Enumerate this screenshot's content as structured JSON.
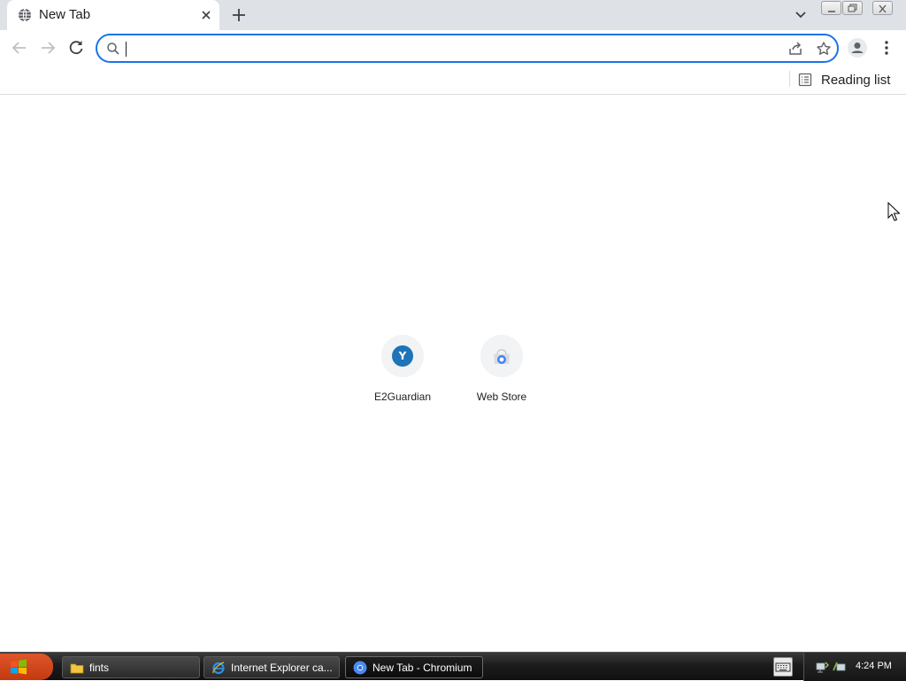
{
  "tab": {
    "title": "New Tab"
  },
  "omnibox": {
    "value": "",
    "placeholder": ""
  },
  "bookmarks_bar": {
    "reading_list_label": "Reading list"
  },
  "shortcuts": [
    {
      "label": "E2Guardian",
      "favicon_letter": "Y",
      "favicon_color": "#1f73b7"
    },
    {
      "label": "Web Store"
    }
  ],
  "taskbar": {
    "items": [
      {
        "label": "fints",
        "icon": "folder-icon"
      },
      {
        "label": "Internet Explorer ca...",
        "icon": "internet-explorer-icon"
      },
      {
        "label": "New Tab - Chromium",
        "icon": "chromium-icon",
        "active": true
      }
    ],
    "clock": "4:24 PM"
  },
  "colors": {
    "accent": "#1a73e8",
    "tabstrip_bg": "#dee1e6",
    "taskbar_bg": "#1c1c1c"
  }
}
